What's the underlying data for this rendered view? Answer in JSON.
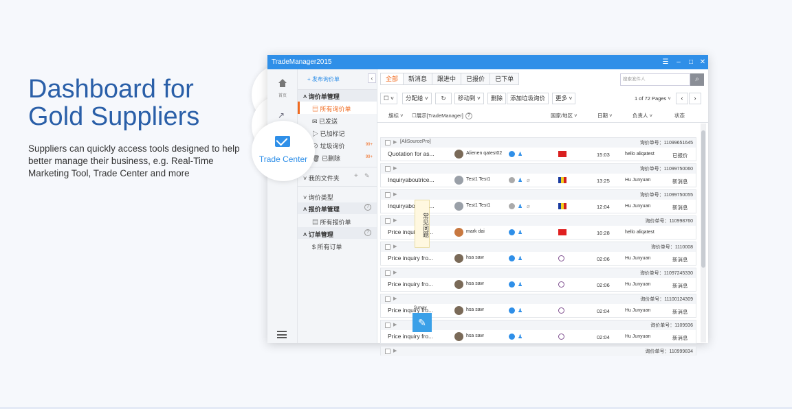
{
  "hero": {
    "title_line1": "Dashboard for",
    "title_line2": "Gold Suppliers",
    "description": "Suppliers can quickly access tools designed to help better manage their business, e.g. Real-Time Marketing Tool, Trade Center and more"
  },
  "bubbles": {
    "trade_center": "Trade Center"
  },
  "window": {
    "title": "TradeManager2015",
    "controls": {
      "menu": "☰",
      "minimize": "–",
      "maximize": "□",
      "close": "✕"
    }
  },
  "rail": {
    "home_label": "首页",
    "menu_icon": "hamburger-icon"
  },
  "sidebar": {
    "new_inquiry": "+ 发布询价单",
    "collapse": "‹",
    "inquiry_mgmt": "询价单管理",
    "items": [
      {
        "label": "所有询价单",
        "count": ""
      },
      {
        "label": "已发送",
        "count": ""
      },
      {
        "label": "已加标记",
        "count": ""
      },
      {
        "label": "垃圾询价",
        "count": "99+"
      },
      {
        "label": "已删除",
        "count": "99+"
      }
    ],
    "my_folders": "我的文件夹",
    "inquiry_type": "询价类型",
    "quote_mgmt": "报价单管理",
    "all_quotes": "所有报价单",
    "order_mgmt": "订单管理",
    "all_orders": "所有订单"
  },
  "main": {
    "tabs": [
      "全部",
      "新消息",
      "跟进中",
      "已报价",
      "已下单"
    ],
    "search_placeholder": "搜索发件人",
    "toolbar": {
      "select": "☐ ˅",
      "assign": "分配给 ˅",
      "refresh": "↻",
      "move": "移动到 ˅",
      "delete": "删除",
      "add_spam": "添加垃圾询价",
      "more": "更多 ˅"
    },
    "pager": "1 of 72 Pages ˅",
    "prev": "‹",
    "next": "›",
    "columns": {
      "flag": "旗标 ˅",
      "show": "☐展示[TradeManager]",
      "country": "国家/地区 ˅",
      "date": "日期 ˅",
      "owner": "负责人 ˅",
      "status": "状态"
    },
    "rows": [
      {
        "source": "[AliSourcePro]",
        "inquiry_no": "询价单号：11099651645",
        "subject": "Quotation for as...",
        "name": "Alienen qatest02",
        "time": "15:03",
        "owner": "hello aliqatest",
        "status": "已报价",
        "flag": "hk"
      },
      {
        "source": "",
        "inquiry_no": "询价单号：11099750060",
        "subject": "Inquiryaboutrice...",
        "name": "Test1 Test1",
        "time": "13:25",
        "owner": "Hu Junyuan",
        "status": "新消息",
        "flag": "ro"
      },
      {
        "source": "",
        "inquiry_no": "询价单号：11099750055",
        "subject": "Inquiryaboutrice...",
        "name": "Test1 Test1",
        "time": "12:04",
        "owner": "Hu Junyuan",
        "status": "新消息",
        "flag": "ro"
      },
      {
        "source": "",
        "inquiry_no": "询价单号：110998760",
        "subject": "Price inquiry fro...",
        "name": "mark dai",
        "time": "10:28",
        "owner": "hello aliqatest",
        "status": "",
        "flag": "cn"
      },
      {
        "source": "",
        "inquiry_no": "询价单号：1110008",
        "subject": "Price inquiry fro...",
        "name": "hsa saw",
        "time": "02:06",
        "owner": "Hu Junyuan",
        "status": "新消息",
        "flag": "x"
      },
      {
        "source": "",
        "inquiry_no": "询价单号：11097245330",
        "subject": "Price inquiry fro...",
        "name": "hsa saw",
        "time": "02:06",
        "owner": "Hu Junyuan",
        "status": "新消息",
        "flag": "x"
      },
      {
        "source": "",
        "inquiry_no": "询价单号：11100124309",
        "subject": "Price inquiry fro...",
        "name": "hsa saw",
        "time": "02:04",
        "owner": "Hu Junyuan",
        "status": "新消息",
        "flag": "x"
      },
      {
        "source": "",
        "inquiry_no": "询价单号：1109936",
        "subject": "Price inquiry fro...",
        "name": "hsa saw",
        "time": "02:04",
        "owner": "Hu Junyuan",
        "status": "新消息",
        "flag": "x"
      },
      {
        "source": "",
        "inquiry_no": "询价单号：110999834",
        "subject": "",
        "name": "",
        "time": "",
        "owner": "",
        "status": "",
        "flag": ""
      }
    ]
  },
  "float": {
    "faq": "常见问题",
    "survey": "Survey"
  }
}
